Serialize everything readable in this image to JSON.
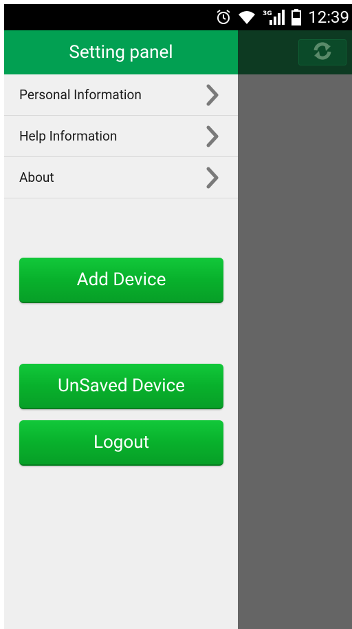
{
  "status_bar": {
    "time": "12:39",
    "icons": [
      "alarm-icon",
      "wifi-icon",
      "3g-signal-icon",
      "battery-icon"
    ],
    "network": "3G"
  },
  "drawer": {
    "title": "Setting panel",
    "items": [
      {
        "label": "Personal Information",
        "icon": "chevron-right-icon"
      },
      {
        "label": "Help Information",
        "icon": "chevron-right-icon"
      },
      {
        "label": "About",
        "icon": "chevron-right-icon"
      }
    ],
    "buttons": {
      "add_device": "Add Device",
      "unsaved_device": "UnSaved Device",
      "logout": "Logout"
    }
  },
  "main": {
    "refresh_icon": "refresh-icon"
  },
  "colors": {
    "header_green": "#02a052",
    "button_green": "#08b12c",
    "overlay_gray": "#656565",
    "menu_bg": "#f0f0f0"
  }
}
